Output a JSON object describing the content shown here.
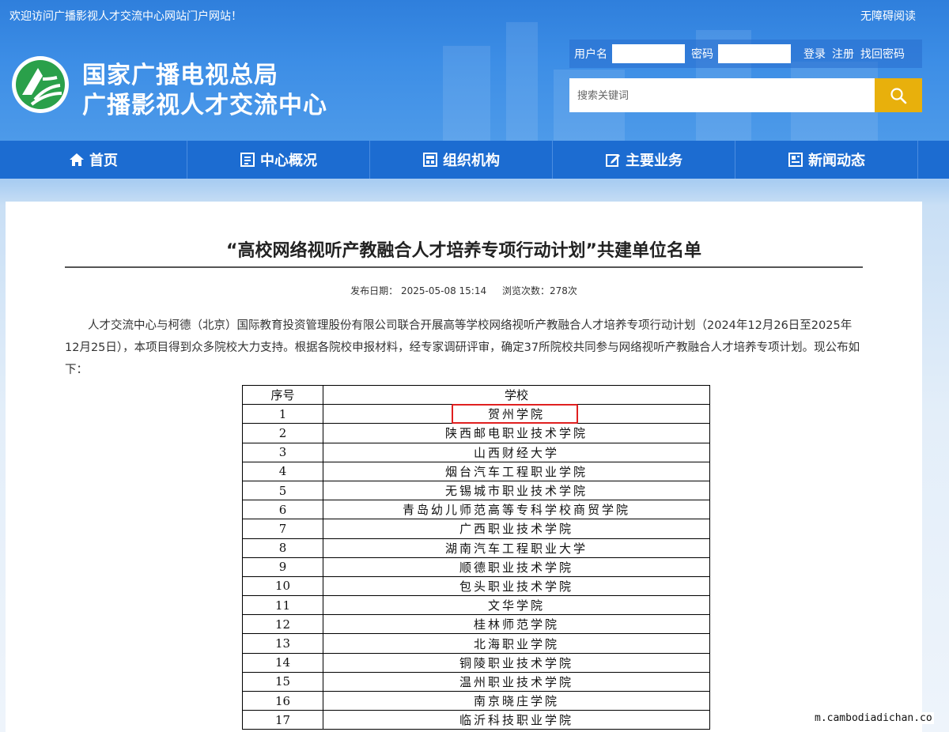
{
  "header": {
    "welcome": "欢迎访问广播影视人才交流中心网站门户网站！",
    "accessible": "无障碍阅读",
    "title_line1": "国家广播电视总局",
    "title_line2": "广播影视人才交流中心",
    "login": {
      "username_label": "用户名",
      "password_label": "密码",
      "login_label": "登录",
      "register_label": "注册",
      "recover_label": "找回密码"
    },
    "search": {
      "placeholder": "搜索关键词"
    }
  },
  "nav": {
    "items": [
      {
        "label": "首页",
        "icon": "home-icon"
      },
      {
        "label": "中心概况",
        "icon": "overview-icon"
      },
      {
        "label": "组织机构",
        "icon": "organization-icon"
      },
      {
        "label": "主要业务",
        "icon": "edit-icon"
      },
      {
        "label": "新闻动态",
        "icon": "news-icon"
      }
    ]
  },
  "article": {
    "title": "“高校网络视听产教融合人才培养专项行动计划”共建单位名单",
    "publish_label": "发布日期：",
    "publish_date": "2025-05-08 15:14",
    "views_label": "浏览次数：",
    "views": "278次",
    "paragraph": "人才交流中心与柯德（北京）国际教育投资管理股份有限公司联合开展高等学校网络视听产教融合人才培养专项行动计划（2024年12月26日至2025年12月25日），本项目得到众多院校大力支持。根据各院校申报材料，经专家调研评审，确定37所院校共同参与网络视听产教融合人才培养专项计划。现公布如下：",
    "table": {
      "headers": [
        "序号",
        "学校"
      ],
      "rows": [
        [
          "1",
          "贺州学院"
        ],
        [
          "2",
          "陕西邮电职业技术学院"
        ],
        [
          "3",
          "山西财经大学"
        ],
        [
          "4",
          "烟台汽车工程职业学院"
        ],
        [
          "5",
          "无锡城市职业技术学院"
        ],
        [
          "6",
          "青岛幼儿师范高等专科学校商贸学院"
        ],
        [
          "7",
          "广西职业技术学院"
        ],
        [
          "8",
          "湖南汽车工程职业大学"
        ],
        [
          "9",
          "顺德职业技术学院"
        ],
        [
          "10",
          "包头职业技术学院"
        ],
        [
          "11",
          "文华学院"
        ],
        [
          "12",
          "桂林师范学院"
        ],
        [
          "13",
          "北海职业学院"
        ],
        [
          "14",
          "铜陵职业技术学院"
        ],
        [
          "15",
          "温州职业技术学院"
        ],
        [
          "16",
          "南京晓庄学院"
        ],
        [
          "17",
          "临沂科技职业学院"
        ]
      ]
    }
  },
  "watermark": "m.cambodiadichan.co",
  "colors": {
    "header_blue": "#2f7fdc",
    "nav_blue": "#1c6cd1",
    "search_yellow": "#e8b00c",
    "highlight_red": "#e02020"
  }
}
